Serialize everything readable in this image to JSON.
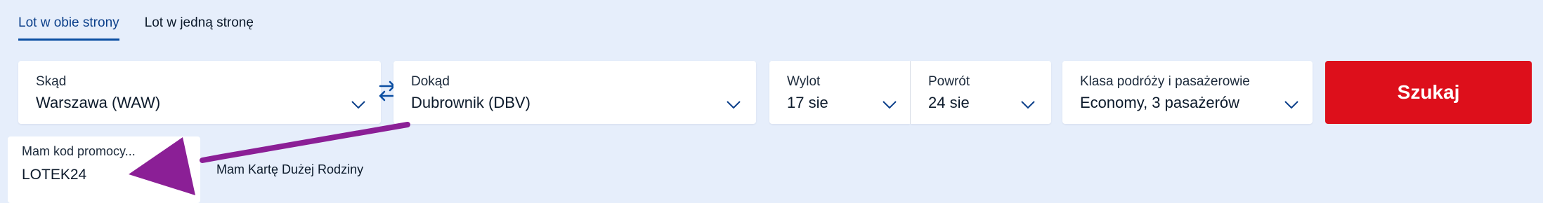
{
  "tabs": [
    {
      "label": "Lot w obie strony",
      "active": true
    },
    {
      "label": "Lot w jedną stronę",
      "active": false
    }
  ],
  "from": {
    "label": "Skąd",
    "value": "Warszawa (WAW)"
  },
  "to": {
    "label": "Dokąd",
    "value": "Dubrownik (DBV)"
  },
  "depart": {
    "label": "Wylot",
    "value": "17 sie"
  },
  "return": {
    "label": "Powrót",
    "value": "24 sie"
  },
  "cabin": {
    "label": "Klasa podróży i pasażerowie",
    "value": "Economy, 3 pasażerów"
  },
  "search": {
    "label": "Szukaj"
  },
  "promo": {
    "label": "Mam kod promocy...",
    "value": "LOTEK24"
  },
  "family_card": {
    "label": "Mam Kartę Dużej Rodziny"
  },
  "colors": {
    "accent": "#0b4ea2",
    "search_button": "#dd0f1b",
    "annotation_arrow": "#8b1f96",
    "background": "#e6eefb"
  },
  "icons": [
    "swap-arrows-icon",
    "chevron-down-icon",
    "annotation-arrow"
  ]
}
